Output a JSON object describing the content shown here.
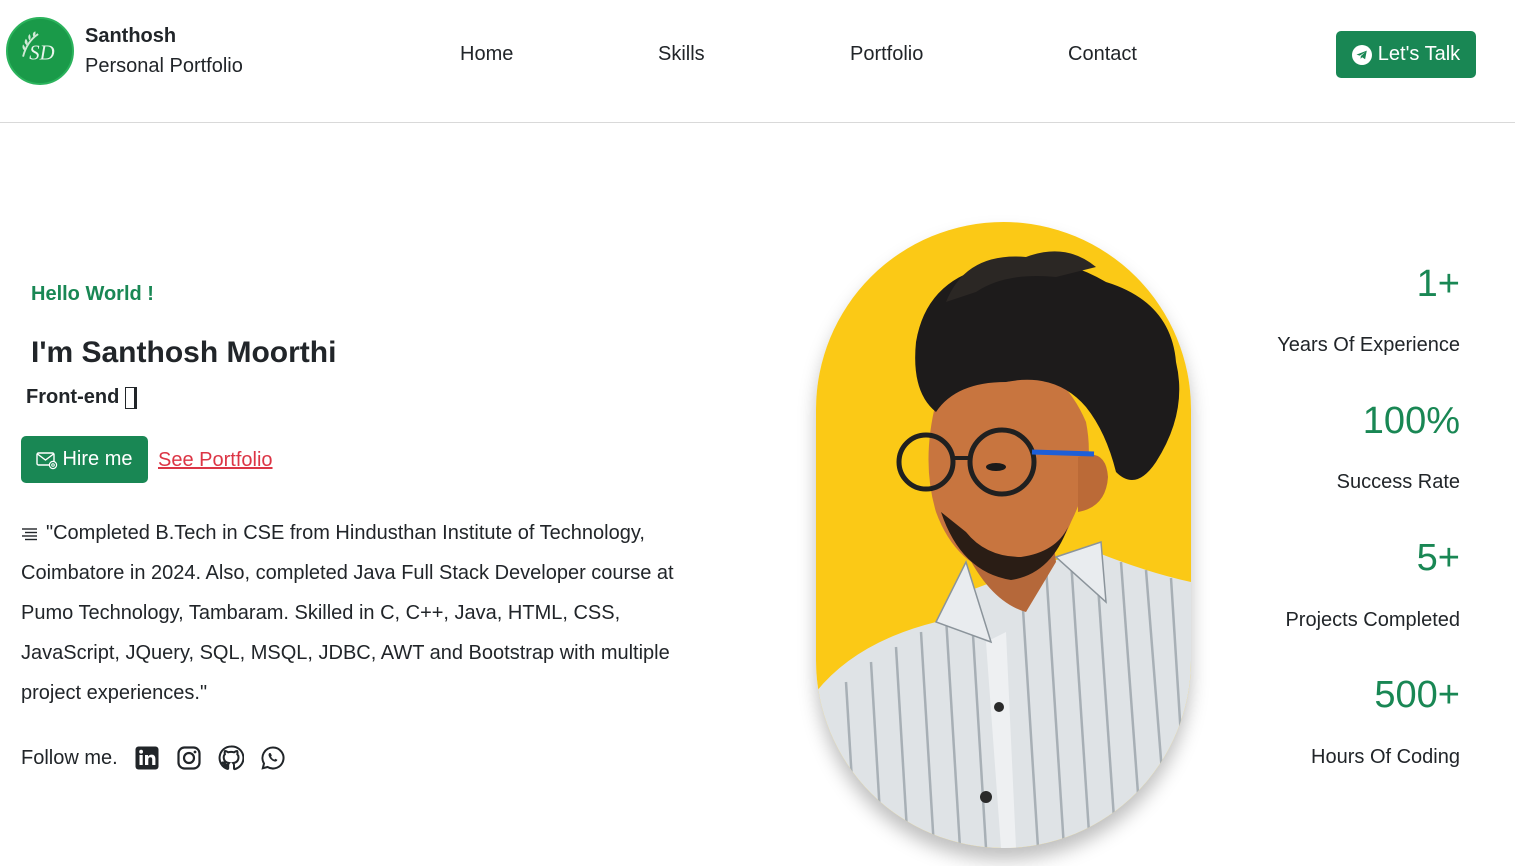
{
  "brand": {
    "name": "Santhosh",
    "subtitle": "Personal Portfolio",
    "logo_text": "SD"
  },
  "nav": {
    "items": [
      "Home",
      "Skills",
      "Portfolio",
      "Contact"
    ],
    "cta_label": "Let's Talk"
  },
  "hero": {
    "greeting": "Hello World !",
    "name": "I'm Santhosh Moorthi",
    "role": "Front-end",
    "hire_label": "Hire me",
    "portfolio_label": "See Portfolio",
    "bio": "\"Completed B.Tech in CSE from Hindusthan Institute of Technology, Coimbatore in 2024. Also, completed Java Full Stack Developer course at Pumo Technology, Tambaram. Skilled in C, C++, Java, HTML, CSS, JavaScript, JQuery, SQL, MSQL, JDBC, AWT and Bootstrap with multiple project experiences.\"",
    "follow_label": "Follow me.",
    "socials": [
      "linkedin-icon",
      "instagram-icon",
      "github-icon",
      "whatsapp-icon"
    ]
  },
  "stats": [
    {
      "value": "1+",
      "label": "Years Of Experience"
    },
    {
      "value": "100%",
      "label": "Success Rate"
    },
    {
      "value": "5+",
      "label": "Projects Completed"
    },
    {
      "value": "500+",
      "label": "Hours Of Coding"
    }
  ],
  "colors": {
    "accent": "#198754",
    "link": "#dc3545",
    "photo_bg": "#fbc916"
  }
}
